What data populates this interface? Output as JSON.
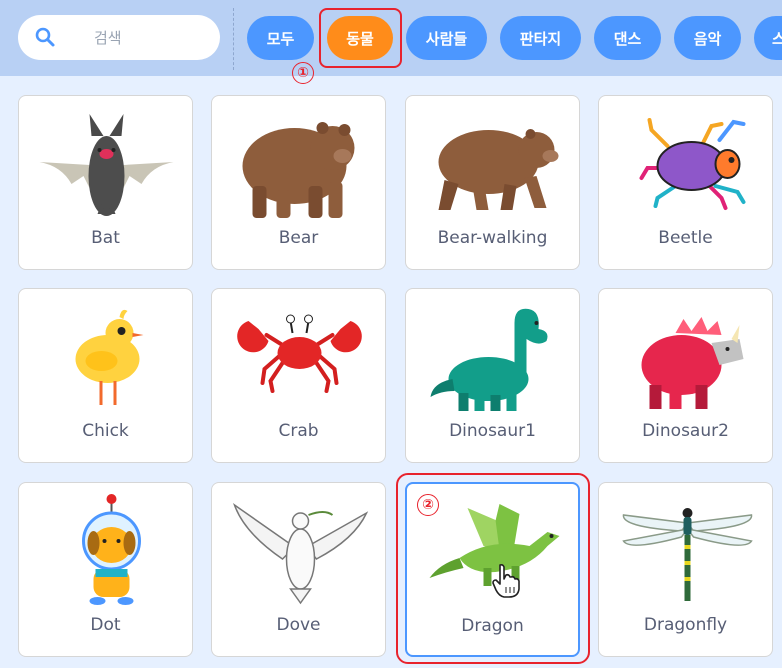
{
  "search": {
    "placeholder": "검색",
    "icon": "search-icon"
  },
  "categories": [
    {
      "label": "모두",
      "active": false
    },
    {
      "label": "동물",
      "active": true
    },
    {
      "label": "사람들",
      "active": false
    },
    {
      "label": "판타지",
      "active": false
    },
    {
      "label": "댄스",
      "active": false
    },
    {
      "label": "음악",
      "active": false
    },
    {
      "label": "스",
      "active": false
    }
  ],
  "annotations": [
    {
      "marker": "①",
      "target": "동물"
    },
    {
      "marker": "②",
      "target": "Dragon"
    }
  ],
  "sprites": [
    {
      "name": "Bat",
      "icon": "bat-icon"
    },
    {
      "name": "Bear",
      "icon": "bear-icon"
    },
    {
      "name": "Bear-walking",
      "icon": "bear-walking-icon"
    },
    {
      "name": "Beetle",
      "icon": "beetle-icon"
    },
    {
      "name": "Chick",
      "icon": "chick-icon"
    },
    {
      "name": "Crab",
      "icon": "crab-icon"
    },
    {
      "name": "Dinosaur1",
      "icon": "dinosaur1-icon"
    },
    {
      "name": "Dinosaur2",
      "icon": "dinosaur2-icon"
    },
    {
      "name": "Dot",
      "icon": "dot-icon"
    },
    {
      "name": "Dove",
      "icon": "dove-icon"
    },
    {
      "name": "Dragon",
      "icon": "dragon-icon",
      "selected": true
    },
    {
      "name": "Dragonfly",
      "icon": "dragonfly-icon"
    }
  ],
  "colors": {
    "topbar": "#b8d0f4",
    "background": "#e6f0ff",
    "pill": "#4c97ff",
    "pill_active": "#ff8c1a",
    "highlight": "#e8232d",
    "selected_border": "#4c97ff"
  }
}
